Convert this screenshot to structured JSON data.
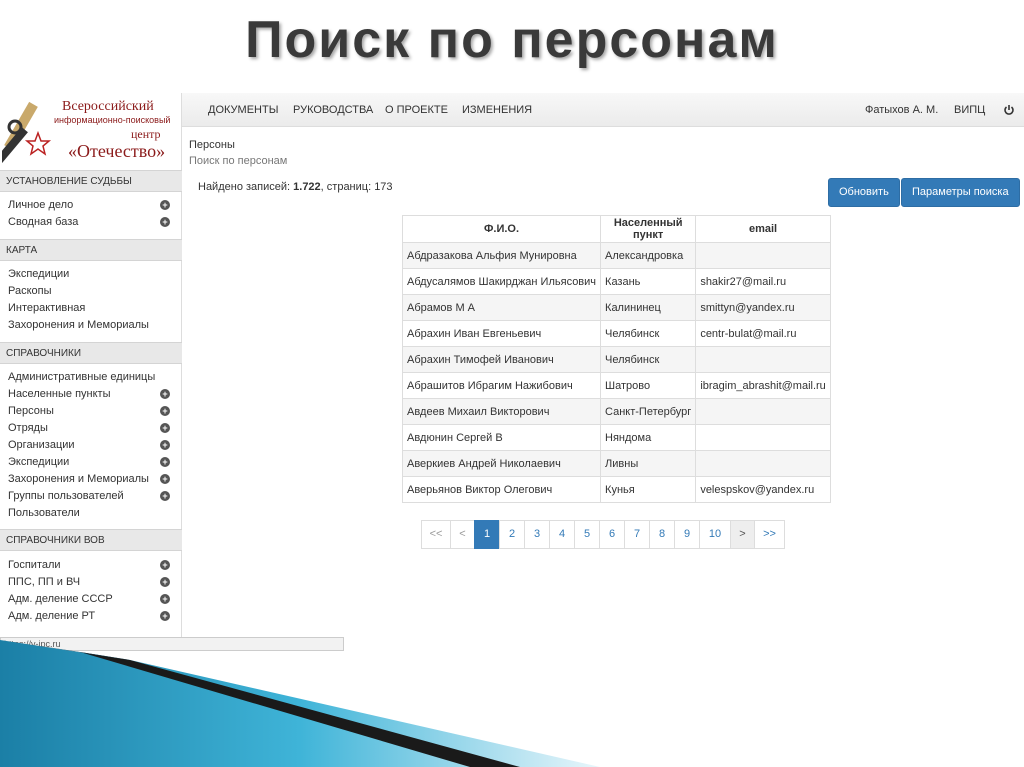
{
  "slide_title": "Поиск по персонам",
  "logo": {
    "line1": "Всероссийский",
    "line2": "информационно-поисковый",
    "line3": "центр",
    "line4": "«Отечество»"
  },
  "nav": {
    "items": [
      "ДОКУМЕНТЫ",
      "РУКОВОДСТВА",
      "О ПРОЕКТЕ",
      "ИЗМЕНЕНИЯ"
    ],
    "user": "Фатыхов А. М.",
    "org": "ВИПЦ"
  },
  "sidebar": {
    "sections": [
      {
        "title": "УСТАНОВЛЕНИЕ СУДЬБЫ",
        "items": [
          "Личное дело",
          "Сводная база"
        ]
      },
      {
        "title": "КАРТА",
        "items": [
          "Экспедиции",
          "Раскопы",
          "Интерактивная",
          "Захоронения и Мемориалы"
        ]
      },
      {
        "title": "СПРАВОЧНИКИ",
        "items": [
          "Административные единицы",
          "Населенные пункты",
          "Персоны",
          "Отряды",
          "Организации",
          "Экспедиции",
          "Захоронения и Мемориалы",
          "Группы пользователей",
          "Пользователи"
        ]
      },
      {
        "title": "СПРАВОЧНИКИ ВОВ",
        "items": [
          "Госпитали",
          "ППС, ПП и ВЧ",
          "Адм. деление СССР",
          "Адм. деление РТ"
        ]
      }
    ]
  },
  "breadcrumb": {
    "section": "Персоны",
    "page": "Поиск по персонам"
  },
  "results": {
    "prefix": "Найдено записей: ",
    "count": "1.722",
    "suffix": ", страниц: 173"
  },
  "buttons": {
    "refresh": "Обновить",
    "params": "Параметры поиска"
  },
  "table": {
    "headers": [
      "Ф.И.О.",
      "Населенный пункт",
      "email"
    ],
    "rows": [
      [
        "Абдразакова Альфия Мунировна",
        "Александровка",
        ""
      ],
      [
        "Абдусалямов Шакирджан Ильясович",
        "Казань",
        "shakir27@mail.ru"
      ],
      [
        "Абрамов М А",
        "Калининец",
        "smittyn@yandex.ru"
      ],
      [
        "Абрахин Иван Евгеньевич",
        "Челябинск",
        "centr-bulat@mail.ru"
      ],
      [
        "Абрахин Тимофей Иванович",
        "Челябинск",
        ""
      ],
      [
        "Абрашитов Ибрагим Нажибович",
        "Шатрово",
        "ibragim_abrashit@mail.ru"
      ],
      [
        "Авдеев Михаил Викторович",
        "Санкт-Петербург",
        ""
      ],
      [
        "Авдюнин Сергей В",
        "Няндома",
        ""
      ],
      [
        "Аверкиев Андрей Николаевич",
        "Ливны",
        ""
      ],
      [
        "Аверьянов Виктор Олегович",
        "Кунья",
        "velespskov@yandex.ru"
      ]
    ]
  },
  "pager": {
    "first": "<<",
    "prev": "<",
    "pages": [
      "1",
      "2",
      "3",
      "4",
      "5",
      "6",
      "7",
      "8",
      "9",
      "10"
    ],
    "next": ">",
    "last": ">>",
    "active": "1"
  },
  "status_url": "https://v-ipc.ru",
  "colors": {
    "primary": "#337ab7",
    "logo_red": "#8b1a1a",
    "deco_blue": "#2a9fc4"
  }
}
